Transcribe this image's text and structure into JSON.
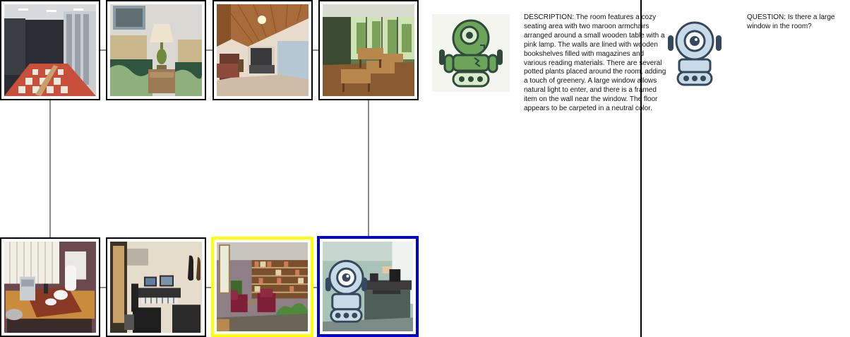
{
  "top_row": [
    {
      "name": "locker-room",
      "icon": "locker-room-photo"
    },
    {
      "name": "bedroom",
      "icon": "bedroom-photo"
    },
    {
      "name": "attic-living-room",
      "icon": "attic-photo"
    },
    {
      "name": "classroom",
      "icon": "classroom-photo"
    }
  ],
  "bottom_row": [
    {
      "name": "kitchen-counter",
      "icon": "kettle-photo",
      "highlight": "none"
    },
    {
      "name": "music-studio",
      "icon": "studio-photo",
      "highlight": "none"
    },
    {
      "name": "reading-room",
      "icon": "reading-room-photo",
      "highlight": "yellow"
    },
    {
      "name": "office",
      "icon": "office-photo",
      "highlight": "blue"
    }
  ],
  "agents": {
    "describer_icon": "green-robot-icon",
    "questioner_icon": "blue-robot-icon"
  },
  "description": "DESCRIPTION: The room features a cozy seating area with two maroon armchairs arranged around a small wooden table with a pink lamp. The walls are lined with wooden bookshelves filled with magazines and various reading materials. There are several potted plants placed around the room, adding a touch of greenery. A large window allows natural light to enter, and there is a framed item on the wall near the window. The floor appears to be carpeted in a neutral color.",
  "question": "QUESTION: Is there a large window in the room?",
  "colors": {
    "highlight_yellow": "#ffff00",
    "highlight_blue": "#0000cc",
    "connector": "#8a8a8a"
  }
}
